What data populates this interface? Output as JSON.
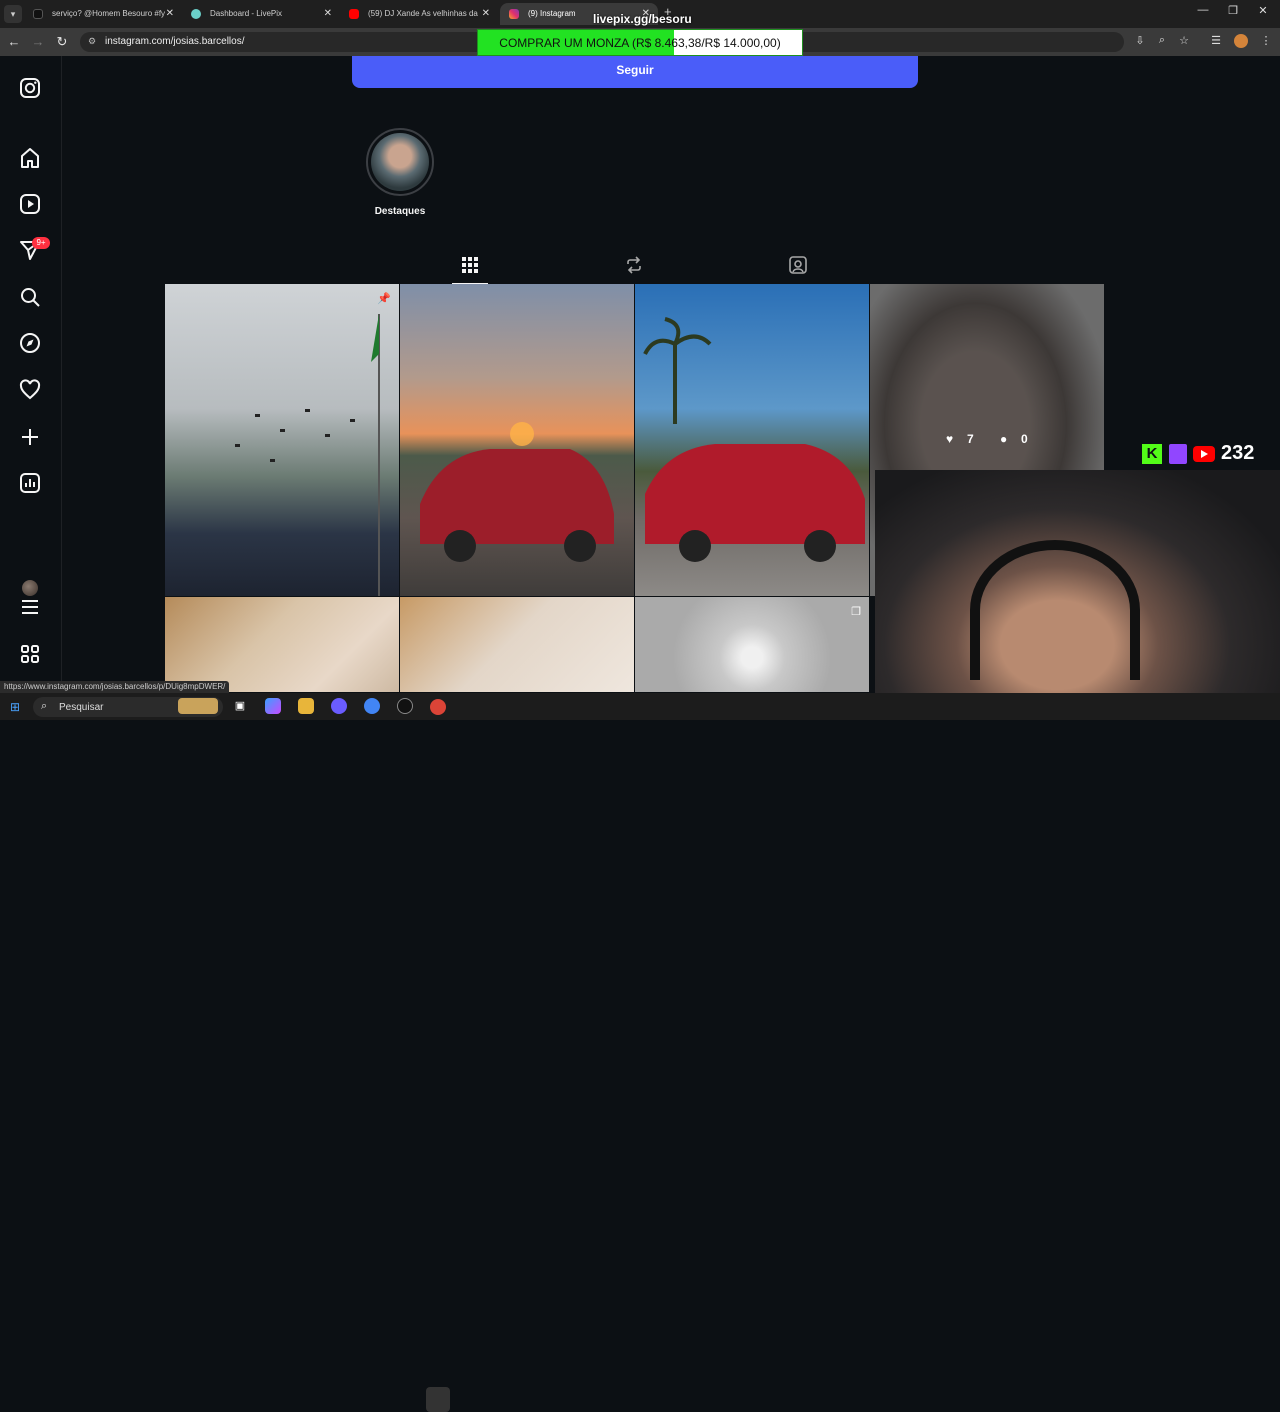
{
  "browser": {
    "tabs": [
      {
        "title": "serviço? @Homem Besouro #fy",
        "active": false
      },
      {
        "title": "Dashboard - LivePix",
        "active": false
      },
      {
        "title": "(59) DJ Xande As velhinhas da",
        "active": false
      },
      {
        "title": "(9) Instagram",
        "active": true
      }
    ],
    "url": "instagram.com/josias.barcellos/",
    "status_url": "https://www.instagram.com/josias.barcellos/p/DUig8mpDWER/"
  },
  "overlay": {
    "livepix_label": "livepix.gg/besoru",
    "goal_text": "COMPRAR UM MONZA (R$ 8.463,38/R$ 14.000,00)",
    "goal_progress": 0.6045,
    "viewer_count": "232"
  },
  "instagram": {
    "follow_label": "Seguir",
    "highlight_label": "Destaques",
    "notifications_badge": "9+",
    "profile_tabs": [
      "grid-icon",
      "reels-icon",
      "tagged-icon"
    ],
    "posts": [
      {
        "name": "post-graduation",
        "pinned": true
      },
      {
        "name": "post-sunset-car"
      },
      {
        "name": "post-red-car"
      },
      {
        "name": "post-selfie",
        "likes": "7",
        "comments": "0"
      },
      {
        "name": "post-mirror-1"
      },
      {
        "name": "post-mirror-2"
      },
      {
        "name": "post-light",
        "carousel": true
      }
    ]
  },
  "taskbar": {
    "search_placeholder": "Pesquisar"
  },
  "colors": {
    "accent": "#4a5df9",
    "badge": "#ff3040",
    "goal_fill": "#22e222",
    "background": "#0c1014"
  }
}
